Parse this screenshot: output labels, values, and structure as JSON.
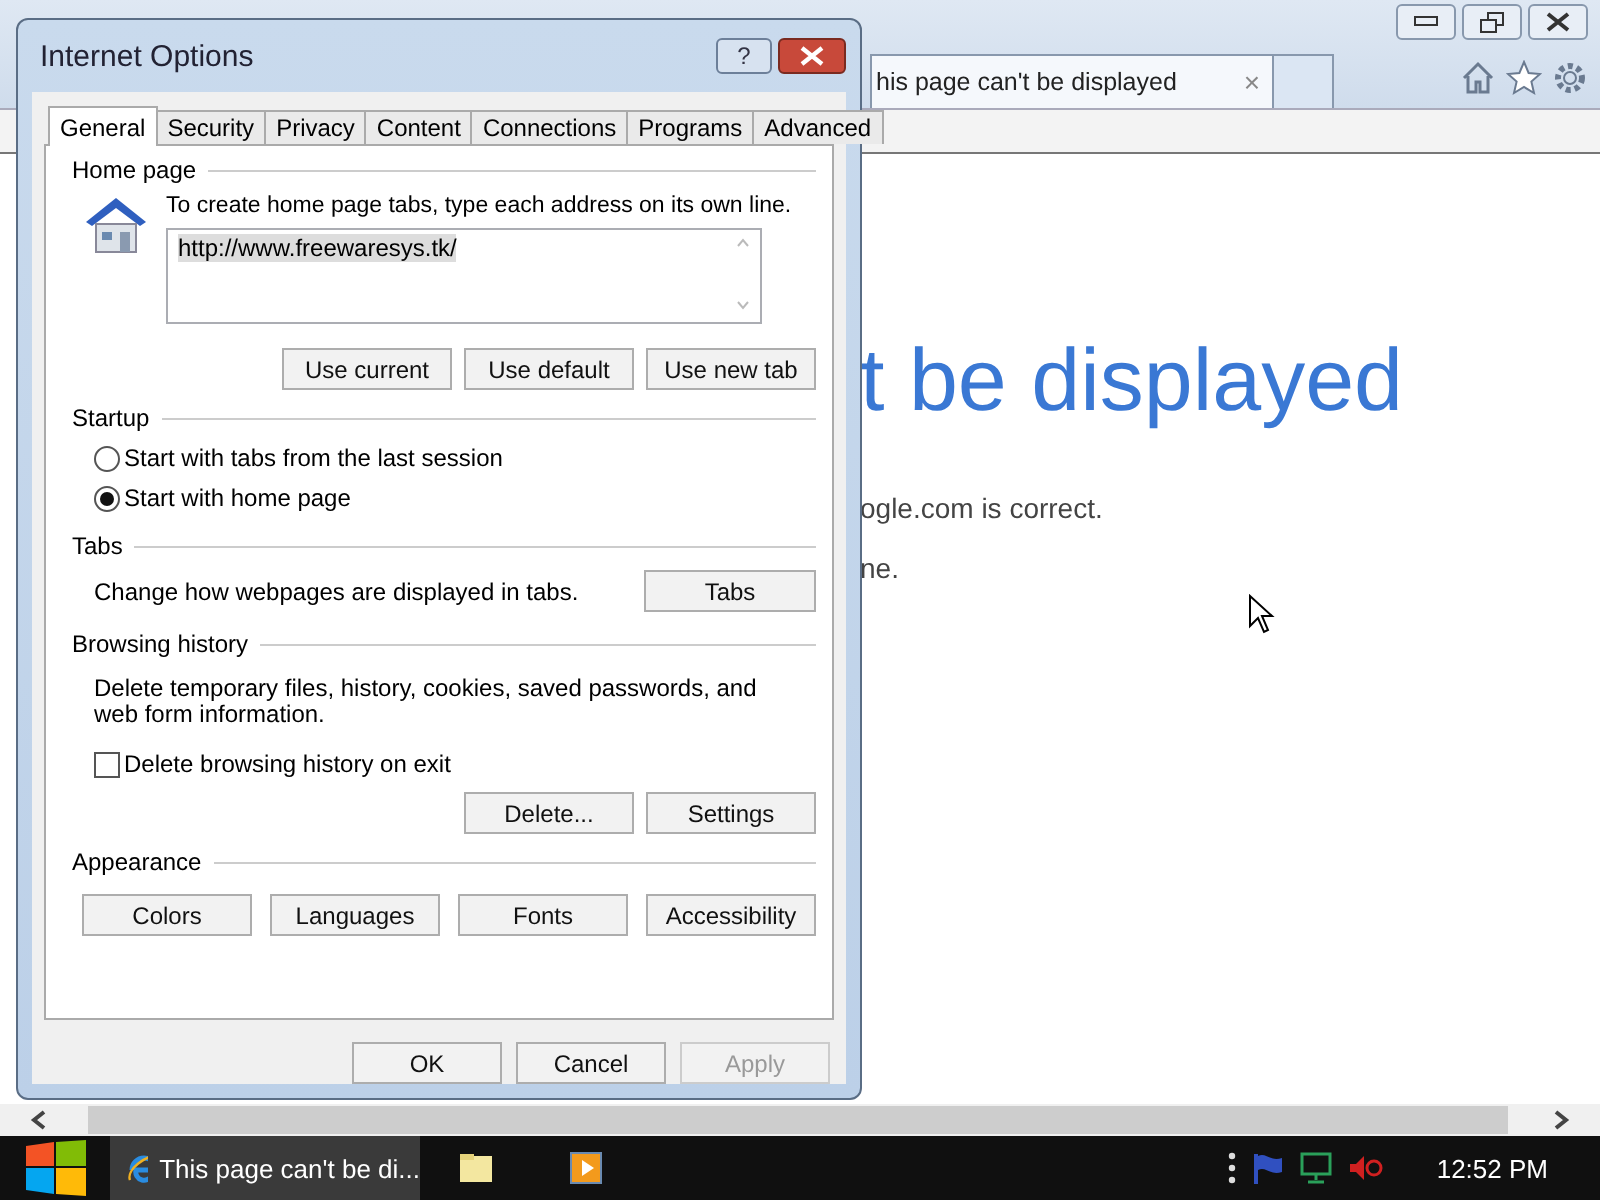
{
  "browser": {
    "tab": {
      "title": "his page can't be displayed",
      "close": "×"
    },
    "heading": "t be displayed",
    "lines": [
      "ogle.com is correct.",
      "ne."
    ]
  },
  "dialog": {
    "title": "Internet Options",
    "help": "?",
    "tabs": [
      {
        "label": "General",
        "selected": true
      },
      {
        "label": "Security",
        "selected": false
      },
      {
        "label": "Privacy",
        "selected": false
      },
      {
        "label": "Content",
        "selected": false
      },
      {
        "label": "Connections",
        "selected": false
      },
      {
        "label": "Programs",
        "selected": false
      },
      {
        "label": "Advanced",
        "selected": false
      }
    ],
    "home_page": {
      "label": "Home page",
      "description": "To create home page tabs, type each address on its own line.",
      "url": "http://www.freewaresys.tk/",
      "buttons": [
        "Use current",
        "Use default",
        "Use new tab"
      ]
    },
    "startup": {
      "label": "Startup",
      "options": [
        {
          "label": "Start with tabs from the last session",
          "selected": false
        },
        {
          "label": "Start with home page",
          "selected": true
        }
      ]
    },
    "tabs_section": {
      "label": "Tabs",
      "description": "Change how webpages are displayed in tabs.",
      "button": "Tabs"
    },
    "browsing_history": {
      "label": "Browsing history",
      "description": "Delete temporary files, history, cookies, saved passwords, and web form information.",
      "delete_on_exit": {
        "label": "Delete browsing history on exit",
        "checked": false
      },
      "buttons": [
        "Delete...",
        "Settings"
      ]
    },
    "appearance": {
      "label": "Appearance",
      "buttons": [
        "Colors",
        "Languages",
        "Fonts",
        "Accessibility"
      ]
    },
    "footer_buttons": [
      {
        "label": "OK",
        "disabled": false
      },
      {
        "label": "Cancel",
        "disabled": false
      },
      {
        "label": "Apply",
        "disabled": true
      }
    ]
  },
  "taskbar": {
    "window_title": "This page can't be di...",
    "clock": "12:52 PM"
  }
}
